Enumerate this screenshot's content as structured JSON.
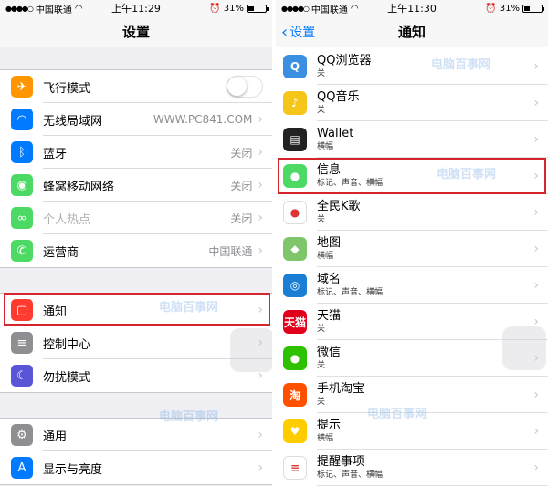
{
  "left": {
    "status": {
      "carrier": "中国联通",
      "time": "上午11:29",
      "battery": "31%",
      "battery_fraction": 0.31
    },
    "nav_title": "设置",
    "group1": [
      {
        "label": "飞行模式",
        "value": "",
        "icon": "airplane-icon",
        "color": "#ff9500",
        "toggle": true
      },
      {
        "label": "无线局域网",
        "value": "WWW.PC841.COM",
        "icon": "wifi-icon",
        "color": "#007aff"
      },
      {
        "label": "蓝牙",
        "value": "关闭",
        "icon": "bluetooth-icon",
        "color": "#007aff"
      },
      {
        "label": "蜂窝移动网络",
        "value": "关闭",
        "icon": "cellular-icon",
        "color": "#4cd964"
      },
      {
        "label": "个人热点",
        "value": "关闭",
        "icon": "hotspot-icon",
        "color": "#4cd964",
        "disabled": true
      },
      {
        "label": "运营商",
        "value": "中国联通",
        "icon": "phone-icon",
        "color": "#4cd964"
      }
    ],
    "group2": [
      {
        "label": "通知",
        "icon": "notifications-icon",
        "color": "#ff3b30"
      },
      {
        "label": "控制中心",
        "icon": "control-center-icon",
        "color": "#8e8e93"
      },
      {
        "label": "勿扰模式",
        "icon": "moon-icon",
        "color": "#5856d6"
      }
    ],
    "group3": [
      {
        "label": "通用",
        "icon": "gear-icon",
        "color": "#8e8e93"
      },
      {
        "label": "显示与亮度",
        "icon": "brightness-icon",
        "color": "#007aff"
      }
    ],
    "watermark": "电脑百事网"
  },
  "right": {
    "status": {
      "carrier": "中国联通",
      "time": "上午11:30",
      "battery": "31%",
      "battery_fraction": 0.31
    },
    "back_label": "设置",
    "nav_title": "通知",
    "apps": [
      {
        "title": "QQ浏览器",
        "sub": "关",
        "icon": "qq-browser-icon",
        "color": "#3a8fe0",
        "glyph": "Q"
      },
      {
        "title": "QQ音乐",
        "sub": "关",
        "icon": "qq-music-icon",
        "color": "#f5c518",
        "glyph": "♪"
      },
      {
        "title": "Wallet",
        "sub": "横幅",
        "icon": "wallet-icon",
        "color": "#222222",
        "glyph": "▤"
      },
      {
        "title": "信息",
        "sub": "标记、声音、横幅",
        "icon": "messages-icon",
        "color": "#4cd964",
        "glyph": "●"
      },
      {
        "title": "全民K歌",
        "sub": "关",
        "icon": "kge-icon",
        "color": "#ffffff",
        "glyph": "●"
      },
      {
        "title": "地图",
        "sub": "横幅",
        "icon": "maps-icon",
        "color": "#7fc66b",
        "glyph": "◆"
      },
      {
        "title": "域名",
        "sub": "标记、声音、横幅",
        "icon": "domain-icon",
        "color": "#1a7fd4",
        "glyph": "◎"
      },
      {
        "title": "天猫",
        "sub": "关",
        "icon": "tmall-icon",
        "color": "#e0001b",
        "glyph": "天猫"
      },
      {
        "title": "微信",
        "sub": "关",
        "icon": "wechat-icon",
        "color": "#2dc100",
        "glyph": "●"
      },
      {
        "title": "手机淘宝",
        "sub": "关",
        "icon": "taobao-icon",
        "color": "#ff5000",
        "glyph": "淘"
      },
      {
        "title": "提示",
        "sub": "横幅",
        "icon": "tips-icon",
        "color": "#ffcc00",
        "glyph": "♥"
      },
      {
        "title": "提醒事项",
        "sub": "标记、声音、横幅",
        "icon": "reminders-icon",
        "color": "#ffffff",
        "glyph": "≡"
      }
    ],
    "watermark": "电脑百事网",
    "watermark_url": "PC841.COM"
  }
}
